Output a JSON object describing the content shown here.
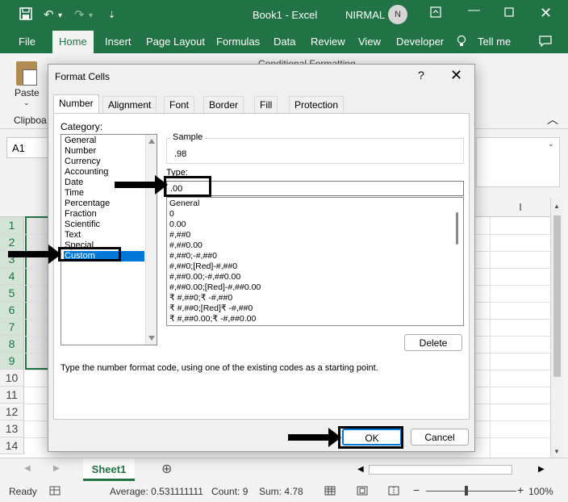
{
  "titlebar": {
    "title": "Book1  -  Excel",
    "user": "NIRMAL",
    "avatar": "N",
    "icons": [
      "save-icon",
      "undo-icon",
      "redo-icon",
      "customize-qat-icon",
      "ribbon-display-icon",
      "minimize-icon",
      "restore-icon",
      "close-icon"
    ]
  },
  "ribbon_tabs": [
    "File",
    "Home",
    "Insert",
    "Page Layout",
    "Formulas",
    "Data",
    "Review",
    "View",
    "Developer",
    "Tell me"
  ],
  "ribbon": {
    "paste": "Paste",
    "clipboard": "Clipboa",
    "conditional": "Conditional Formatting"
  },
  "namebox": "A1",
  "grid": {
    "rows": [
      "1",
      "2",
      "3",
      "4",
      "5",
      "6",
      "7",
      "8",
      "9",
      "10",
      "11",
      "12",
      "13",
      "14"
    ],
    "col_visible": "I"
  },
  "sheet_tab": "Sheet1",
  "status": {
    "ready": "Ready",
    "average": "Average: 0.531111111",
    "count": "Count: 9",
    "sum": "Sum: 4.78",
    "zoom": "100%"
  },
  "dialog": {
    "title": "Format Cells",
    "help": "?",
    "tabs": [
      "Number",
      "Alignment",
      "Font",
      "Border",
      "Fill",
      "Protection"
    ],
    "category_label": "Category:",
    "categories": [
      "General",
      "Number",
      "Currency",
      "Accounting",
      "Date",
      "Time",
      "Percentage",
      "Fraction",
      "Scientific",
      "Text",
      "Special",
      "Custom"
    ],
    "selected_category": "Custom",
    "sample_label": "Sample",
    "sample_value": ".98",
    "type_label": "Type:",
    "type_value": ".00",
    "type_list": [
      "General",
      "0",
      "0.00",
      "#,##0",
      "#,##0.00",
      "#,##0;-#,##0",
      "#,##0;[Red]-#,##0",
      "#,##0.00;-#,##0.00",
      "#,##0.00;[Red]-#,##0.00",
      "₹ #,##0;₹ -#,##0",
      "₹ #,##0;[Red]₹ -#,##0",
      "₹ #,##0.00;₹ -#,##0.00"
    ],
    "delete": "Delete",
    "hint": "Type the number format code, using one of the existing codes as a starting point.",
    "ok": "OK",
    "cancel": "Cancel"
  }
}
